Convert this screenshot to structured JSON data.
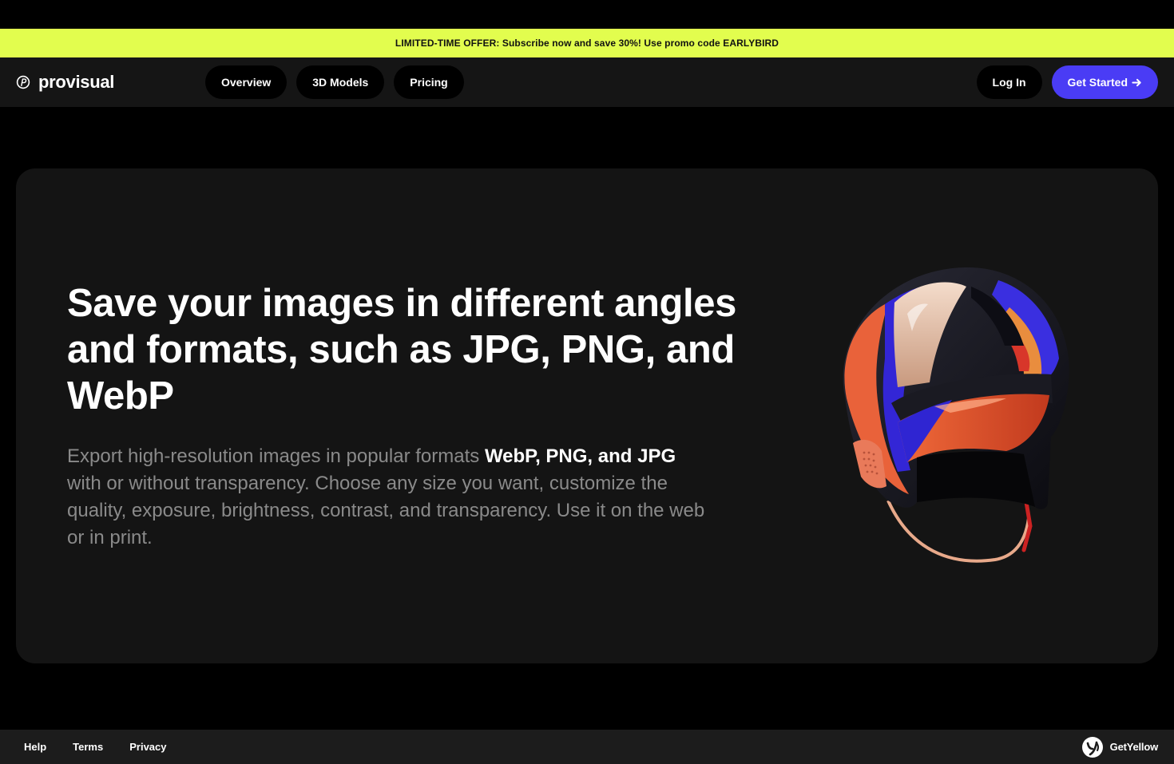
{
  "promo": {
    "text": "LIMITED-TIME OFFER: Subscribe now and save 30%! Use promo code EARLYBIRD"
  },
  "nav": {
    "brand": "provisual",
    "brand_icon": "provisual-logo-icon",
    "links": [
      "Overview",
      "3D Models",
      "Pricing"
    ],
    "login_label": "Log In",
    "cta_label": "Get Started",
    "cta_icon": "arrow-right-icon"
  },
  "hero": {
    "title": "Save your images in different angles and formats, such as JPG, PNG, and WebP",
    "desc_part1": "Export high-resolution images in popular formats ",
    "desc_bold": "WebP, PNG, and JPG",
    "desc_part2": " with or without transparency. Choose any size you want, customize the quality, exposure, brightness, contrast, and transparency. Use it on the web or in print.",
    "image": "helmet-3d-model"
  },
  "footer": {
    "links": [
      "Help",
      "Terms",
      "Privacy"
    ],
    "brand": "GetYellow",
    "brand_icon": "getyellow-logo-icon"
  },
  "colors": {
    "promo_bg": "#e2fd4e",
    "accent": "#4a3cf5",
    "card_bg": "#141414",
    "nav_bg": "#151515"
  }
}
